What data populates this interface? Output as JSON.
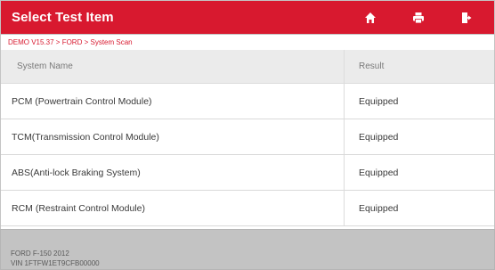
{
  "header": {
    "title": "Select Test Item",
    "icons": [
      "home-icon",
      "print-icon",
      "exit-icon"
    ]
  },
  "breadcrumb": "DEMO V15.37 > FORD > System Scan",
  "table": {
    "columns": [
      "System Name",
      "Result"
    ],
    "rows": [
      {
        "name": "PCM (Powertrain Control Module)",
        "result": "Equipped"
      },
      {
        "name": "TCM(Transmission Control Module)",
        "result": "Equipped"
      },
      {
        "name": "ABS(Anti-lock Braking System)",
        "result": "Equipped"
      },
      {
        "name": "RCM (Restraint Control Module)",
        "result": "Equipped"
      }
    ]
  },
  "footer": {
    "vehicle": "FORD F-150 2012",
    "vin": "VIN 1FTFW1ET9CFB00000"
  },
  "colors": {
    "accent": "#d8192f",
    "footer_bg": "#c3c3c3"
  }
}
